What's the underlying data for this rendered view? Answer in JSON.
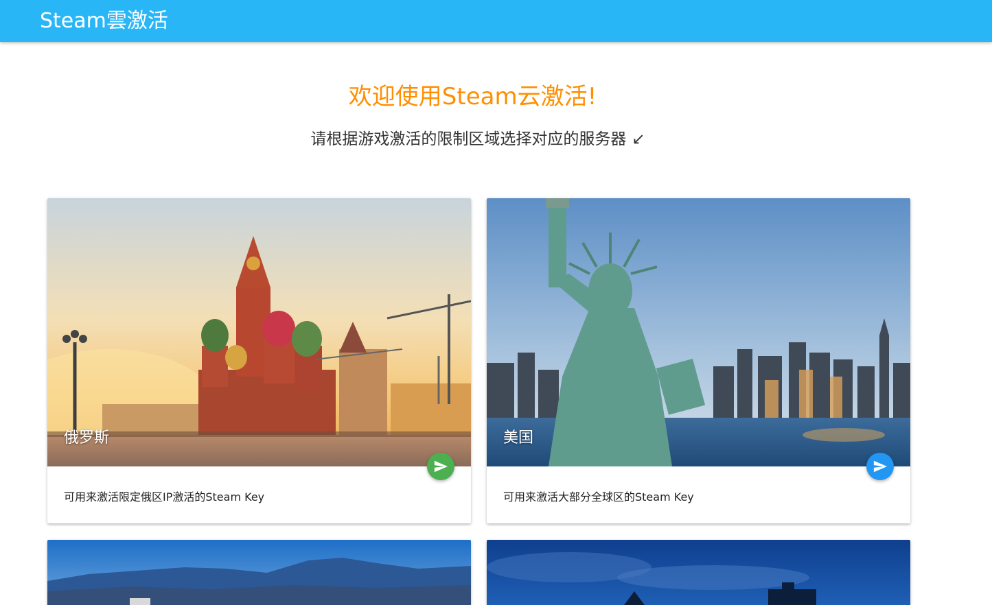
{
  "appbar": {
    "title": "Steam雲激活"
  },
  "hero": {
    "title": "欢迎使用Steam云激活!",
    "subtitle": "请根据游戏激活的限制区域选择对应的服务器",
    "arrow": "↙"
  },
  "colors": {
    "appbar": "#29b6f6",
    "hero_title": "#ff8f00",
    "fab_green": "#4caf50",
    "fab_blue": "#2196f3"
  },
  "cards": [
    {
      "title": "俄罗斯",
      "description": "可用来激活限定俄区IP激活的Steam Key",
      "fab_icon": "send-icon"
    },
    {
      "title": "美国",
      "description": "可用来激活大部分全球区的Steam Key",
      "fab_icon": "send-icon"
    }
  ]
}
